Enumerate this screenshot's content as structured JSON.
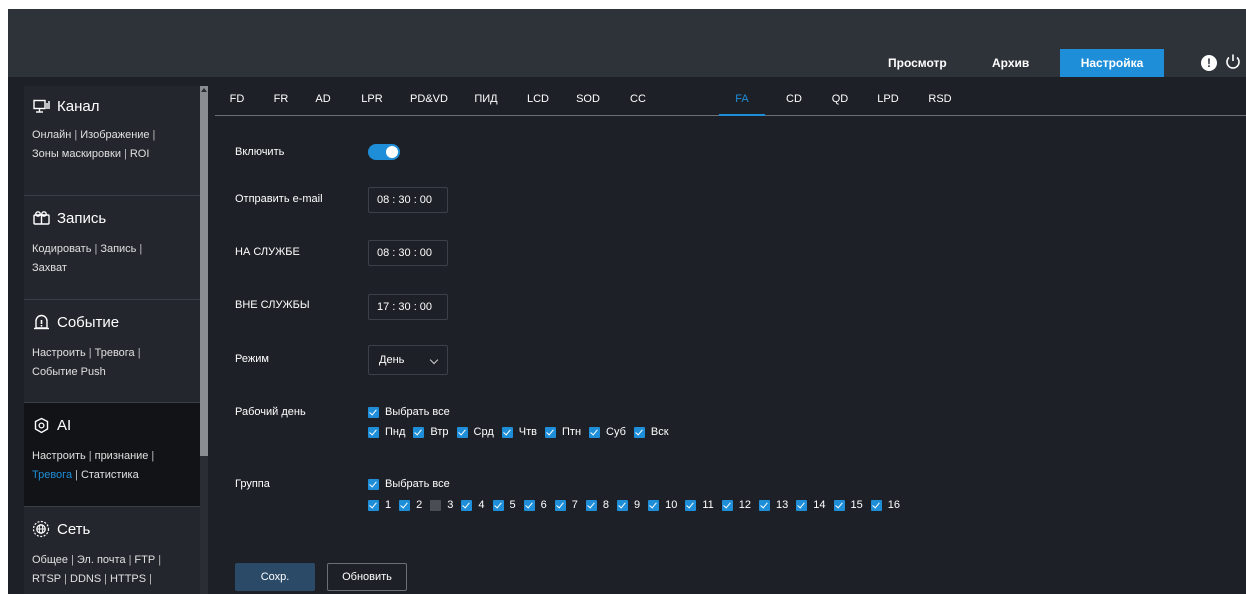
{
  "topnav": {
    "items": [
      {
        "label": "Просмотр"
      },
      {
        "label": "Архив"
      },
      {
        "label": "Настройка",
        "active": true
      }
    ],
    "alert_icon_glyph": "!"
  },
  "sidebar": {
    "sections": [
      {
        "title": "Канал",
        "icon": "monitor-icon",
        "links": [
          "Онлайн",
          "Изображение",
          "Зоны маскировки",
          "ROI"
        ]
      },
      {
        "title": "Запись",
        "icon": "record-icon",
        "links": [
          "Кодировать",
          "Запись",
          "Захват"
        ]
      },
      {
        "title": "Событие",
        "icon": "alarm-icon",
        "links": [
          "Настроить",
          "Тревога",
          "Событие Push"
        ]
      },
      {
        "title": "AI",
        "icon": "ai-icon",
        "links": [
          "Настроить",
          "признание",
          "Тревога",
          "Статистика"
        ],
        "active_link": "Тревога"
      },
      {
        "title": "Сеть",
        "icon": "network-icon",
        "links": [
          "Общее",
          "Эл. почта",
          "FTP",
          "RTSP",
          "DDNS",
          "HTTPS"
        ]
      }
    ]
  },
  "tabs": [
    {
      "label": "FD"
    },
    {
      "label": "FR"
    },
    {
      "label": "AD"
    },
    {
      "label": "LPR"
    },
    {
      "label": "PD&VD"
    },
    {
      "label": "ПИД"
    },
    {
      "label": "LCD"
    },
    {
      "label": "SOD"
    },
    {
      "label": "CC"
    },
    {
      "label": "FA",
      "active": true
    },
    {
      "label": "CD"
    },
    {
      "label": "QD"
    },
    {
      "label": "LPD"
    },
    {
      "label": "RSD"
    }
  ],
  "form": {
    "enable_label": "Включить",
    "enable_value": true,
    "email_label": "Отправить e-mail",
    "email_time": "08 : 30 : 00",
    "on_duty_label": "НА СЛУЖБЕ",
    "on_duty_time": "08 : 30 : 00",
    "off_duty_label": "ВНЕ СЛУЖБЫ",
    "off_duty_time": "17 : 30 : 00",
    "mode_label": "Режим",
    "mode_value": "День",
    "workday_label": "Рабочий день",
    "select_all_label": "Выбрать все",
    "days": [
      {
        "label": "Пнд",
        "checked": true
      },
      {
        "label": "Втр",
        "checked": true
      },
      {
        "label": "Срд",
        "checked": true
      },
      {
        "label": "Чтв",
        "checked": true
      },
      {
        "label": "Птн",
        "checked": true
      },
      {
        "label": "Суб",
        "checked": true
      },
      {
        "label": "Вск",
        "checked": true
      }
    ],
    "group_label": "Группа",
    "groups": [
      {
        "label": "1",
        "checked": true
      },
      {
        "label": "2",
        "checked": true
      },
      {
        "label": "3",
        "checked": false
      },
      {
        "label": "4",
        "checked": true
      },
      {
        "label": "5",
        "checked": true
      },
      {
        "label": "6",
        "checked": true
      },
      {
        "label": "7",
        "checked": true
      },
      {
        "label": "8",
        "checked": true
      },
      {
        "label": "9",
        "checked": true
      },
      {
        "label": "10",
        "checked": true
      },
      {
        "label": "11",
        "checked": true
      },
      {
        "label": "12",
        "checked": true
      },
      {
        "label": "13",
        "checked": true
      },
      {
        "label": "14",
        "checked": true
      },
      {
        "label": "15",
        "checked": true
      },
      {
        "label": "16",
        "checked": true
      }
    ],
    "save_label": "Сохр.",
    "refresh_label": "Обновить"
  },
  "colors": {
    "accent": "#1e8ed8",
    "background": "#1d2026",
    "header": "#2e3239"
  }
}
